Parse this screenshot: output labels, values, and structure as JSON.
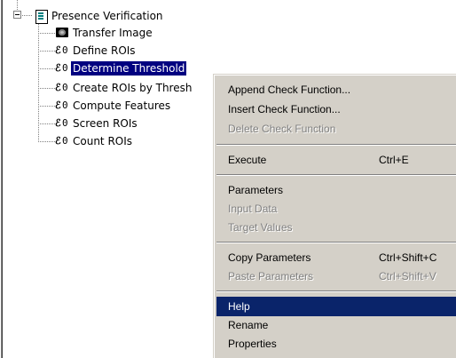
{
  "tree": {
    "root_label": "Presence Verification",
    "children": [
      {
        "label": "Transfer Image",
        "icon": "transfer-image-icon"
      },
      {
        "label": "Define ROIs",
        "icon": "check-function-icon"
      },
      {
        "label": "Determine Threshold",
        "icon": "check-function-icon",
        "selected": true
      },
      {
        "label": "Create ROIs by Thresh",
        "icon": "check-function-icon"
      },
      {
        "label": "Compute Features",
        "icon": "check-function-icon"
      },
      {
        "label": "Screen ROIs",
        "icon": "check-function-icon"
      },
      {
        "label": "Count ROIs",
        "icon": "check-function-icon"
      }
    ]
  },
  "menu": {
    "items": [
      {
        "label": "Append Check Function...",
        "shortcut": "",
        "enabled": true
      },
      {
        "label": "Insert Check Function...",
        "shortcut": "",
        "enabled": true
      },
      {
        "label": "Delete Check Function",
        "shortcut": "",
        "enabled": false
      },
      {
        "label": "Execute",
        "shortcut": "Ctrl+E",
        "enabled": true
      },
      {
        "label": "Parameters",
        "shortcut": "",
        "enabled": true
      },
      {
        "label": "Input Data",
        "shortcut": "",
        "enabled": false
      },
      {
        "label": "Target Values",
        "shortcut": "",
        "enabled": false
      },
      {
        "label": "Copy Parameters",
        "shortcut": "Ctrl+Shift+C",
        "enabled": true
      },
      {
        "label": "Paste Parameters",
        "shortcut": "Ctrl+Shift+V",
        "enabled": false
      },
      {
        "label": "Help",
        "shortcut": "",
        "enabled": true,
        "highlighted": true
      },
      {
        "label": "Rename",
        "shortcut": "",
        "enabled": true
      },
      {
        "label": "Properties",
        "shortcut": "",
        "enabled": true
      }
    ]
  },
  "colors": {
    "selection": "#000080",
    "menu_highlight": "#0a246a",
    "menu_background": "#d4d0c8"
  }
}
